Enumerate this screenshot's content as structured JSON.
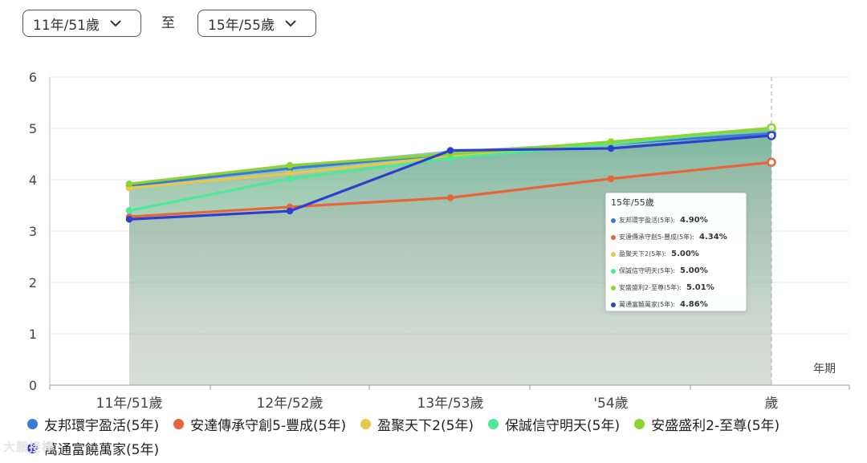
{
  "controls": {
    "from_select": "11年/51歲",
    "to_label": "至",
    "to_select": "15年/55歲"
  },
  "chart_data": {
    "type": "area",
    "categories": [
      "11年/51歲",
      "12年/52歲",
      "13年/53歲",
      "'54歲",
      "歲"
    ],
    "ylim": [
      0,
      6
    ],
    "yticks": [
      "0",
      "1",
      "2",
      "3",
      "4",
      "5",
      "6"
    ],
    "xlabel": "年期",
    "grid": true,
    "legend_position": "bottom",
    "series": [
      {
        "name": "友邦環宇盈活(5年)",
        "color": "#3a7bd5",
        "values": [
          3.88,
          4.22,
          4.5,
          4.7,
          4.9
        ]
      },
      {
        "name": "安達傳承守創5-豐成(5年)",
        "color": "#e8643a",
        "values": [
          3.28,
          3.47,
          3.65,
          4.02,
          4.34
        ]
      },
      {
        "name": "盈聚天下2(5年)",
        "color": "#e8c84a",
        "values": [
          3.84,
          4.12,
          4.45,
          4.7,
          5.0
        ]
      },
      {
        "name": "保誠信守明天(5年)",
        "color": "#4de89a",
        "values": [
          3.4,
          4.02,
          4.42,
          4.7,
          5.0
        ]
      },
      {
        "name": "安盛盛利2-至尊(5年)",
        "color": "#8ed430",
        "values": [
          3.92,
          4.28,
          4.5,
          4.74,
          5.01
        ]
      },
      {
        "name": "萬通富饒萬家(5年)",
        "color": "#2e3fcf",
        "values": [
          3.23,
          3.39,
          4.57,
          4.61,
          4.86
        ]
      }
    ],
    "tooltip": {
      "title": "15年/55歲",
      "rows": [
        {
          "name": "友邦環宇盈活(5年):",
          "value": "4.90%"
        },
        {
          "name": "安達傳承守創5-豐成(5年):",
          "value": "4.34%"
        },
        {
          "name": "盈聚天下2(5年):",
          "value": "5.00%"
        },
        {
          "name": "保誠信守明天(5年):",
          "value": "5.00%"
        },
        {
          "name": "安盛盛利2-至尊(5年):",
          "value": "5.01%"
        },
        {
          "name": "萬通富饒萬家(5年):",
          "value": "4.86%"
        }
      ]
    }
  },
  "watermark": "大鵬接棒"
}
